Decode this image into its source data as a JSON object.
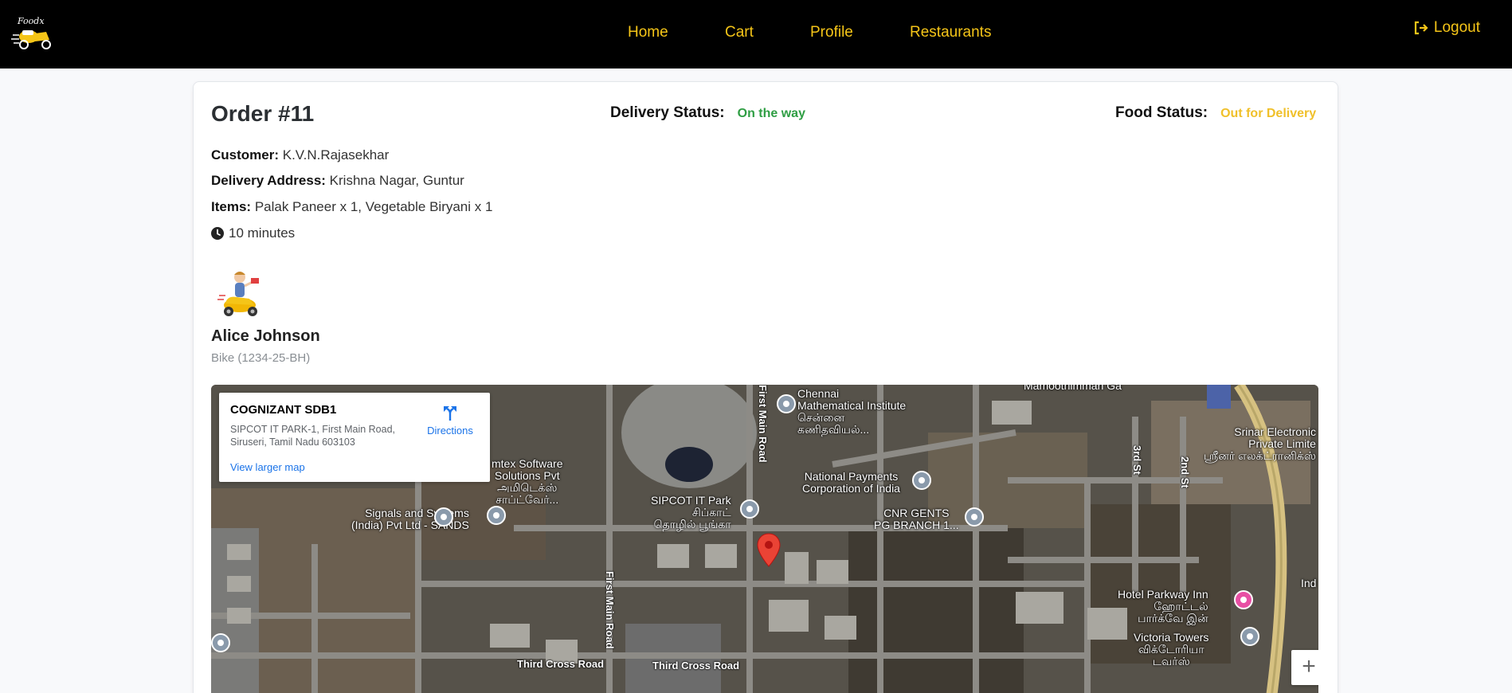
{
  "nav": {
    "links": [
      "Home",
      "Cart",
      "Profile",
      "Restaurants"
    ],
    "logout_label": "Logout",
    "logo_text": "Foodx"
  },
  "order": {
    "title": "Order #11",
    "delivery_status_label": "Delivery Status:",
    "delivery_status_value": "On the way",
    "food_status_label": "Food Status:",
    "food_status_value": "Out for Delivery",
    "customer_label": "Customer:",
    "customer_value": "K.V.N.Rajasekhar",
    "address_label": "Delivery Address:",
    "address_value": "Krishna Nagar, Guntur",
    "items_label": "Items:",
    "items_value": "Palak Paneer x 1, Vegetable Biryani x 1",
    "eta": "10 minutes"
  },
  "rider": {
    "name": "Alice Johnson",
    "vehicle": "Bike (1234-25-BH)"
  },
  "map": {
    "info_title": "COGNIZANT SDB1",
    "info_address": "SIPCOT IT PARK-1, First Main Road, Siruseri, Tamil Nadu 603103",
    "directions_label": "Directions",
    "larger_map_label": "View larger map",
    "zoom_in_label": "+",
    "labels": {
      "cmi": "Chennai\nMathematical Institute\nசென்னை\nகணிதவியல்...",
      "ampt": "Mamoothimman Ga",
      "amtex": "mtex Software\nSolutions Pvt\nஅமிடெக்ஸ்\nசாப்ட்வேர்...",
      "signals": "Signals and Systems\n(India) Pvt Ltd - SANDS",
      "sipcot": "SIPCOT IT Park\nசிப்காட்\nதொழில் பூங்கா",
      "npci": "National Payments\nCorporation of India",
      "cnr": "CNR GENTS\nPG BRANCH 1...",
      "srinar": "Srinar Electronic\nPrivate Limite\nஸ்ரீனர் எலக்ட்ரானிக்ஸ்",
      "parkway": "Hotel Parkway Inn\nஹோட்டல்\nபார்க்வே இன்",
      "victoria": "Victoria Towers\nவிக்டோரியா\nடவர்ஸ்",
      "ind": "Ind",
      "first_main_road": "First Main Road",
      "third_cross_road": "Third Cross Road",
      "third_st": "3rd St",
      "second_st": "2nd St"
    }
  }
}
